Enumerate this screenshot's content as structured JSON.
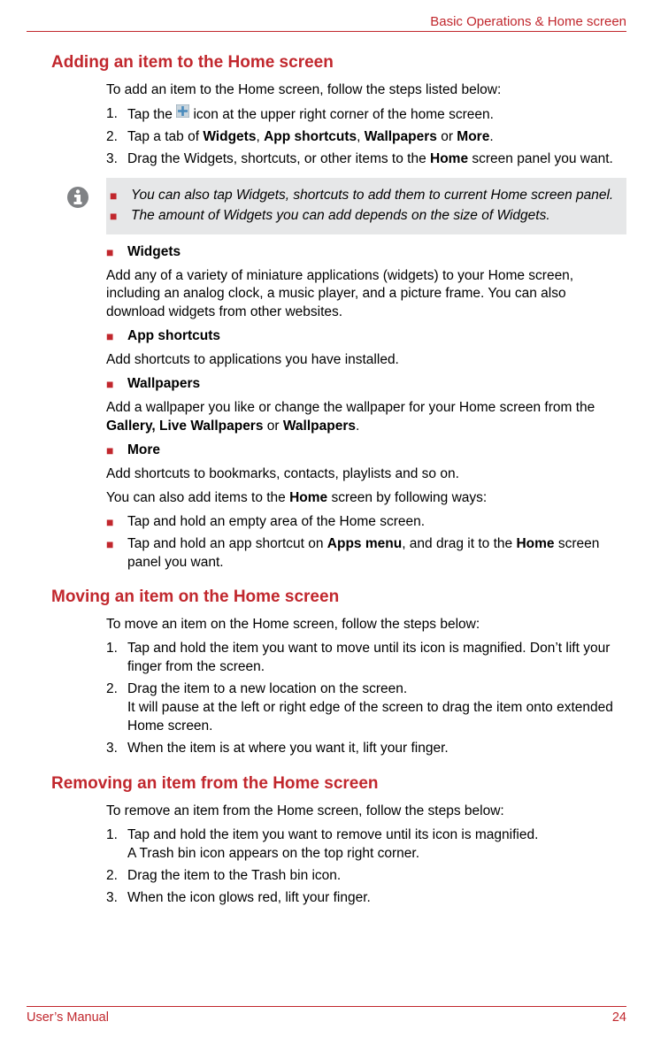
{
  "header": {
    "chapter": "Basic Operations & Home screen"
  },
  "sectionA": {
    "title": "Adding an item to the Home screen",
    "intro": "To add an item to the Home screen, follow the steps listed below:",
    "step1_a": "Tap the ",
    "step1_b": " icon at the upper right corner of the home screen.",
    "step2_a": "Tap a tab of ",
    "step2_b": "Widgets",
    "step2_c": ", ",
    "step2_d": "App shortcuts",
    "step2_e": ", ",
    "step2_f": "Wallpapers",
    "step2_g": " or ",
    "step2_h": "More",
    "step2_i": ".",
    "step3_a": "Drag the Widgets, shortcuts, or other items to the ",
    "step3_b": "Home",
    "step3_c": " screen panel you want.",
    "note1": "You can also tap Widgets, shortcuts to add them to current Home screen panel.",
    "note2": "The amount of Widgets you can add depends on the size of Widgets.",
    "sub_widgets_t": "Widgets",
    "sub_widgets_p": "Add any of a variety of miniature applications (widgets) to your Home screen, including an analog clock, a music player, and a picture frame. You can also download widgets from other websites.",
    "sub_apps_t": "App shortcuts",
    "sub_apps_p": "Add shortcuts to applications you have installed.",
    "sub_wall_t": "Wallpapers",
    "sub_wall_p_a": "Add a wallpaper you like or change the wallpaper for your Home screen from the ",
    "sub_wall_p_b": "Gallery, Live Wallpapers",
    "sub_wall_p_c": " or ",
    "sub_wall_p_d": "Wallpapers",
    "sub_wall_p_e": ".",
    "sub_more_t": "More",
    "sub_more_p": "Add shortcuts to bookmarks, contacts, playlists and so on.",
    "also_a": "You can also add items to the ",
    "also_b": "Home",
    "also_c": " screen by following ways:",
    "way1": "Tap and hold an empty area of the Home screen.",
    "way2_a": "Tap and hold an app shortcut on ",
    "way2_b": "Apps menu",
    "way2_c": ", and drag it to the ",
    "way2_d": "Home",
    "way2_e": " screen panel you want."
  },
  "sectionB": {
    "title": "Moving an item on the Home screen",
    "intro": "To move an item on the Home screen, follow the steps below:",
    "step1": "Tap and hold the item you want to move until its icon is magnified. Don’t lift your finger from the screen.",
    "step2_a": "Drag the item to a new location on the screen.",
    "step2_b": "It will pause at the left or right edge of the screen to drag the item onto extended Home screen.",
    "step3": "When the item is at where you want it, lift your finger."
  },
  "sectionC": {
    "title": "Removing an item from the Home screen",
    "intro": "To remove an item from the Home screen, follow the steps below:",
    "step1_a": "Tap and hold the item you want to remove until its icon is magnified.",
    "step1_b": "A Trash bin icon appears on the top right corner.",
    "step2": "Drag the item to the Trash bin icon.",
    "step3": "When the icon glows red, lift your finger."
  },
  "footer": {
    "left": "User’s Manual",
    "right": "24"
  }
}
